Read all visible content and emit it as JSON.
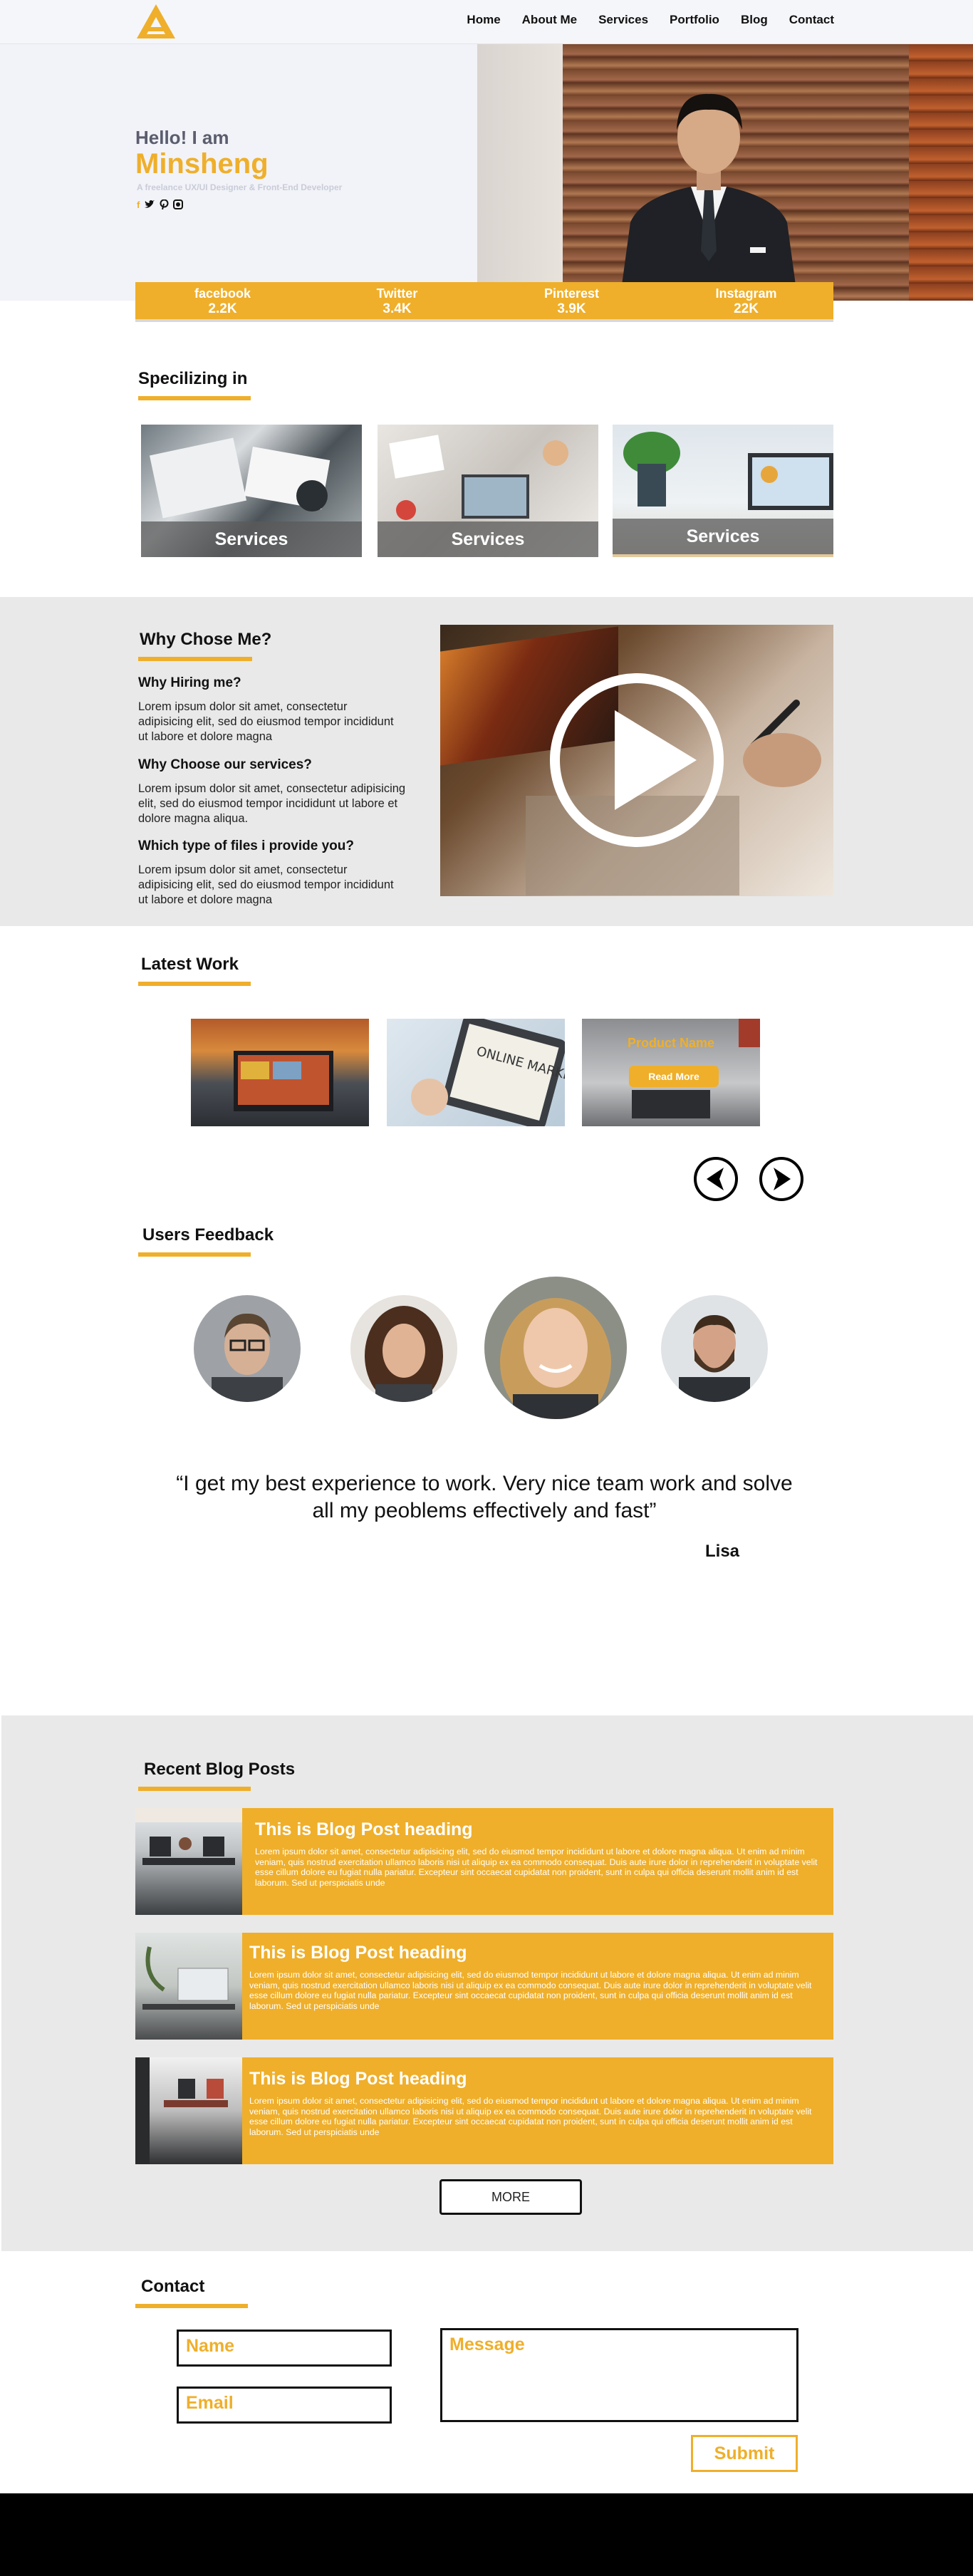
{
  "nav": {
    "links": [
      "Home",
      "About Me",
      "Services",
      "Portfolio",
      "Blog",
      "Contact"
    ]
  },
  "hero": {
    "greeting": "Hello! I am",
    "name": "Minsheng",
    "tagline": "A freelance UX/UI Designer & Front-End Developer",
    "social_icons": [
      "facebook-icon",
      "twitter-icon",
      "pinterest-icon",
      "instagram-icon"
    ]
  },
  "stats": [
    {
      "label": "facebook",
      "count": "2.2K"
    },
    {
      "label": "Twitter",
      "count": "3.4K"
    },
    {
      "label": "Pinterest",
      "count": "3.9K"
    },
    {
      "label": "Instagram",
      "count": "22K"
    }
  ],
  "services": {
    "heading": "Specilizing in",
    "items": [
      "Services",
      "Services",
      "Services"
    ]
  },
  "why": {
    "heading": "Why Chose Me?",
    "items": [
      {
        "q": "Why Hiring me?",
        "a": "Lorem ipsum dolor sit amet, consectetur adipisicing elit, sed do eiusmod tempor incididunt ut labore et dolore magna"
      },
      {
        "q": "Why Choose our services?",
        "a": "Lorem ipsum dolor sit amet, consectetur adipisicing elit, sed do eiusmod tempor incididunt ut labore et dolore magna aliqua."
      },
      {
        "q": "Which type of files i provide you?",
        "a": "Lorem ipsum dolor sit amet, consectetur adipisicing elit, sed do eiusmod tempor incididunt ut labore et dolore magna"
      }
    ]
  },
  "work": {
    "heading": "Latest Work",
    "marketing_text": "ONLINE MARKETING",
    "product_name": "Product Name",
    "read_more": "Read More"
  },
  "feedback": {
    "heading": "Users Feedback",
    "quote": "“I get my best experience to work. Very nice team work and solve all my peoblems effectively and fast”",
    "author": "Lisa"
  },
  "blog": {
    "heading": "Recent Blog Posts",
    "posts": [
      {
        "title": "This is Blog Post heading",
        "body": "Lorem ipsum dolor sit amet, consectetur adipisicing elit, sed do eiusmod tempor incididunt ut labore et dolore magna aliqua. Ut enim ad minim veniam, quis nostrud exercitation ullamco laboris nisi ut aliquip ex ea commodo consequat. Duis aute irure dolor in reprehenderit in voluptate velit esse cillum dolore eu fugiat nulla pariatur. Excepteur sint occaecat cupidatat non proident, sunt in culpa qui officia deserunt mollit anim id est laborum. Sed ut perspiciatis unde"
      },
      {
        "title": "This is Blog Post heading",
        "body": "Lorem ipsum dolor sit amet, consectetur adipisicing elit, sed do eiusmod tempor incididunt ut labore et dolore magna aliqua. Ut enim ad minim veniam, quis nostrud exercitation ullamco laboris nisi ut aliquip ex ea commodo consequat. Duis aute irure dolor in reprehenderit in voluptate velit esse cillum dolore eu fugiat nulla pariatur. Excepteur sint occaecat cupidatat non proident, sunt in culpa qui officia deserunt mollit anim id est laborum. Sed ut perspiciatis unde"
      },
      {
        "title": "This is Blog Post heading",
        "body": "Lorem ipsum dolor sit amet, consectetur adipisicing elit, sed do eiusmod tempor incididunt ut labore et dolore magna aliqua. Ut enim ad minim veniam, quis nostrud exercitation ullamco laboris nisi ut aliquip ex ea commodo consequat. Duis aute irure dolor in reprehenderit in voluptate velit esse cillum dolore eu fugiat nulla pariatur. Excepteur sint occaecat cupidatat non proident, sunt in culpa qui officia deserunt mollit anim id est laborum. Sed ut perspiciatis unde"
      }
    ],
    "more_label": "MORE"
  },
  "contact": {
    "heading": "Contact",
    "name_placeholder": "Name",
    "email_placeholder": "Email",
    "message_placeholder": "Message",
    "submit_label": "Submit"
  },
  "colors": {
    "accent": "#efaf2b",
    "section_gray": "#e9e9e9",
    "footer": "#000000"
  }
}
